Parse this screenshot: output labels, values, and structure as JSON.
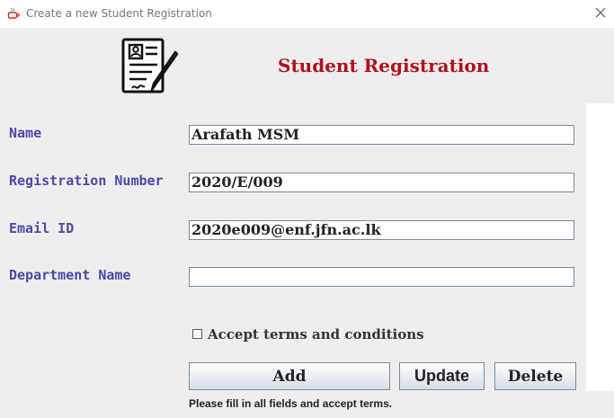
{
  "window": {
    "title": "Create a new Student Registration",
    "icon": "java-app-icon",
    "close_icon": "close-icon"
  },
  "header": {
    "icon": "registration-form-icon",
    "title": "Student Registration",
    "title_color": "#b0101e"
  },
  "form": {
    "fields": [
      {
        "label": "Name",
        "value": "Arafath MSM"
      },
      {
        "label": "Registration Number",
        "value": "2020/E/009"
      },
      {
        "label": "Email ID",
        "value": "2020e009@enf.jfn.ac.lk"
      },
      {
        "label": "Department Name",
        "value": ""
      }
    ],
    "label_color": "#4a4aa6",
    "terms": {
      "label": "Accept terms and conditions",
      "checked": false
    }
  },
  "buttons": {
    "add": "Add",
    "update": "Update",
    "delete": "Delete"
  },
  "status": "Please fill in all fields and accept terms."
}
